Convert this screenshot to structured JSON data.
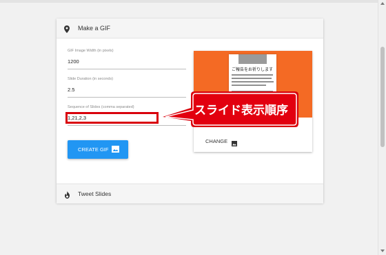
{
  "card": {
    "header_title": "Make a GIF",
    "header_icon": "map-pin-icon",
    "footer_title": "Tweet Slides",
    "footer_icon": "flame-icon"
  },
  "form": {
    "width_label": "GIF Image Width (in pixels)",
    "width_value": "1200",
    "duration_label": "Slide Duration (in seconds)",
    "duration_value": "2.5",
    "sequence_label": "Sequence of Slides (comma separated)",
    "sequence_value": "1,21,2,3",
    "create_button_label": "CREATE GIF",
    "create_button_icon": "image-icon"
  },
  "preview": {
    "doc_title": "ご報告をお祈りします",
    "change_label": "CHANGE",
    "change_icon": "image-icon"
  },
  "annotation": {
    "text": "スライド表示順序",
    "color": "#d9000b"
  },
  "colors": {
    "accent_blue": "#2196f3",
    "preview_orange": "#f46a24"
  }
}
